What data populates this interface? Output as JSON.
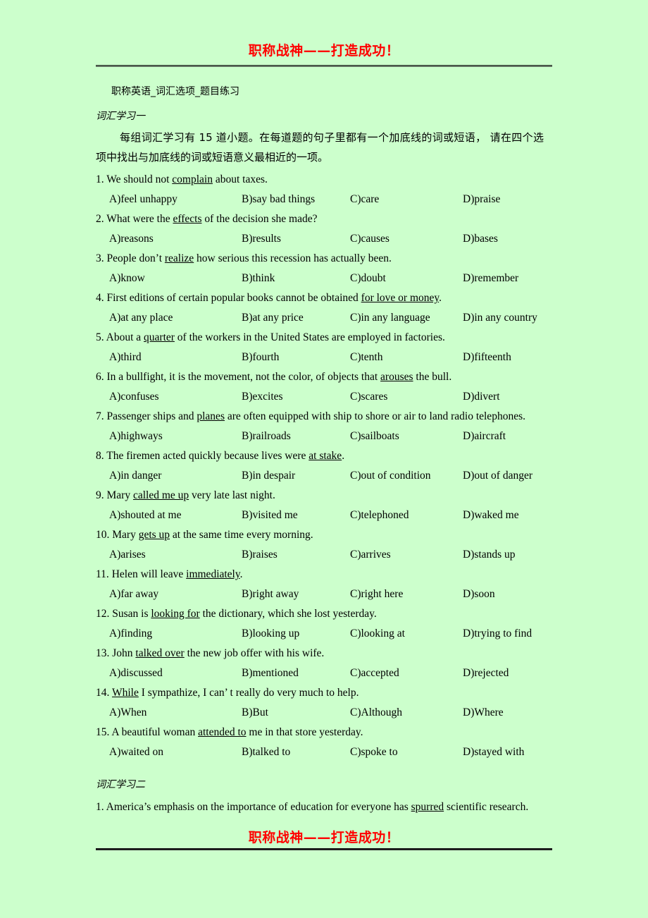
{
  "header": {
    "banner_text": "职称战神——打造成功！",
    "banner_color": "#ff0000",
    "rule_color": "#4a5a4a"
  },
  "footer": {
    "banner_text": "职称战神——打造成功！",
    "banner_color": "#ff0000",
    "rule_color": "#111111"
  },
  "page": {
    "background_color": "#ccffcc",
    "doc_subtitle": "职称英语_词汇选项_题目练习"
  },
  "section_one": {
    "heading": "词汇学习一",
    "instruction": "每组词汇学习有 15 道小题。在每道题的句子里都有一个加底线的词或短语， 请在四个选项中找出与加底线的词或短语意义最相近的一项。",
    "questions": [
      {
        "number": "1.",
        "stem_before": " We should not ",
        "stem_underline": "complain",
        "stem_after": " about taxes.",
        "options": {
          "a": "A)feel unhappy",
          "b": "B)say bad things",
          "c": "C)care",
          "d": "D)praise"
        }
      },
      {
        "number": "2.",
        "stem_before": " What were the ",
        "stem_underline": "effects",
        "stem_after": " of the decision she made?",
        "options": {
          "a": "A)reasons",
          "b": "B)results",
          "c": "C)causes",
          "d": "D)bases"
        }
      },
      {
        "number": "3.",
        "stem_before": " People don’t ",
        "stem_underline": "realize",
        "stem_after": " how serious this recession has actually been.",
        "options": {
          "a": "A)know",
          "b": "B)think",
          "c": "C)doubt",
          "d": "D)remember"
        }
      },
      {
        "number": "4.",
        "stem_before": " First editions of certain popular books cannot be obtained ",
        "stem_underline": "for love or money",
        "stem_after": ".",
        "options": {
          "a": "A)at any place",
          "b": "B)at any price",
          "c": "C)in any language",
          "d": "D)in any country"
        }
      },
      {
        "number": "5.",
        "stem_before": " About a ",
        "stem_underline": "quarter",
        "stem_after": " of the workers in the United States are employed in factories.",
        "options": {
          "a": "A)third",
          "b": "B)fourth",
          "c": "C)tenth",
          "d": "D)fifteenth"
        }
      },
      {
        "number": "6.",
        "stem_before": " In a bullfight, it is the movement, not the color, of objects that ",
        "stem_underline": "arouses",
        "stem_after": " the bull.",
        "options": {
          "a": "A)confuses",
          "b": "B)excites",
          "c": "C)scares",
          "d": "D)divert"
        }
      },
      {
        "number": "7.",
        "stem_before": " Passenger ships and ",
        "stem_underline": "planes",
        "stem_after": " are often equipped with ship to shore or air to land radio telephones.",
        "options": {
          "a": "A)highways",
          "b": "B)railroads",
          "c": "C)sailboats",
          "d": "D)aircraft"
        }
      },
      {
        "number": "8.",
        "stem_before": " The firemen acted quickly because lives were ",
        "stem_underline": "at stake",
        "stem_after": ".",
        "options": {
          "a": "A)in danger",
          "b": "B)in despair",
          "c": "C)out of condition",
          "d": "D)out of danger"
        }
      },
      {
        "number": "9.",
        "stem_before": " Mary ",
        "stem_underline": "called me up",
        "stem_after": " very late last night.",
        "options": {
          "a": "A)shouted at me",
          "b": "B)visited me",
          "c": "C)telephoned",
          "d": "D)waked me"
        }
      },
      {
        "number": "10.",
        "stem_before": " Mary ",
        "stem_underline": "gets up",
        "stem_after": " at the same time every morning.",
        "options": {
          "a": "A)arises",
          "b": "B)raises",
          "c": "C)arrives",
          "d": "D)stands up"
        }
      },
      {
        "number": "11.",
        "stem_before": " Helen will leave ",
        "stem_underline": "immediately",
        "stem_after": ".",
        "options": {
          "a": "A)far away",
          "b": "B)right away",
          "c": "C)right here",
          "d": "D)soon"
        }
      },
      {
        "number": "12.",
        "stem_before": " Susan is ",
        "stem_underline": "looking for",
        "stem_after": " the dictionary, which she lost yesterday.",
        "options": {
          "a": "A)finding",
          "b": "B)looking up",
          "c": "C)looking at",
          "d": "D)trying to find"
        }
      },
      {
        "number": "13.",
        "stem_before": " John ",
        "stem_underline": "talked over",
        "stem_after": " the new job offer with his wife.",
        "options": {
          "a": "A)discussed",
          "b": "B)mentioned",
          "c": "C)accepted",
          "d": "D)rejected"
        }
      },
      {
        "number": "14.",
        "stem_before": " ",
        "stem_underline": "While",
        "stem_after": " I sympathize, I can’ t really do very much to help.",
        "options": {
          "a": "A)When",
          "b": "B)But",
          "c": "C)Although",
          "d": "D)Where"
        }
      },
      {
        "number": "15.",
        "stem_before": " A beautiful woman ",
        "stem_underline": "attended to",
        "stem_after": " me in that store yesterday.",
        "options": {
          "a": "A)waited on",
          "b": "B)talked to",
          "c": "C)spoke to",
          "d": "D)stayed with"
        }
      }
    ]
  },
  "section_two": {
    "heading": "词汇学习二",
    "questions": [
      {
        "number": "1.",
        "stem_before": " America’s emphasis on the importance of education for everyone has ",
        "stem_underline": "spurred",
        "stem_after": " scientific research."
      }
    ]
  }
}
